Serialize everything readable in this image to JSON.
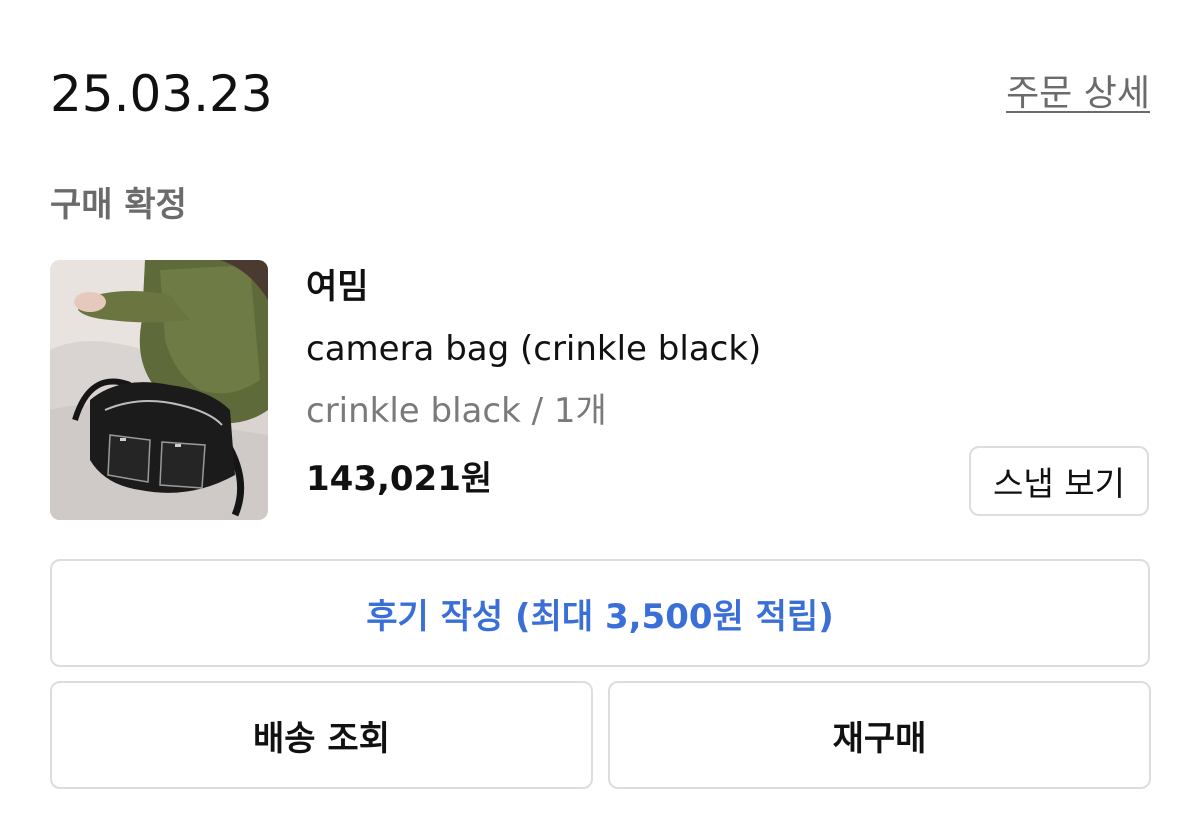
{
  "order": {
    "date": "25.03.23",
    "detail_link": "주문 상세",
    "status": "구매 확정"
  },
  "product": {
    "brand": "여밈",
    "name": "camera bag (crinkle black)",
    "option": "crinkle black / 1개",
    "price": "143,021원",
    "thumbnail_icon": "product-photo-bag"
  },
  "actions": {
    "snap_label": "스냅 보기",
    "review_label": "후기 작성 (최대 3,500원 적립)",
    "tracking_label": "배송 조회",
    "rebuy_label": "재구매"
  },
  "colors": {
    "accent_blue": "#3a6fd8",
    "muted_text": "#6b6b6b",
    "border": "#dddddd"
  }
}
